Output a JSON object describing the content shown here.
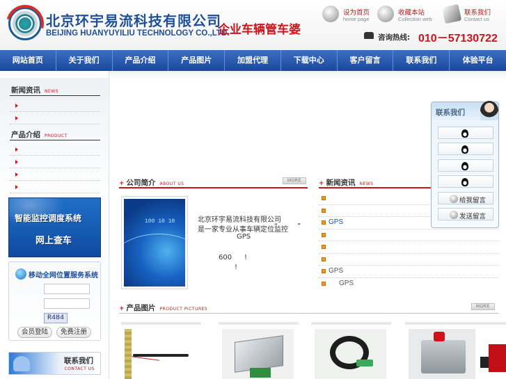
{
  "header": {
    "company_cn": "北京环宇易流科技有限公司",
    "company_en": "BEIJING HUANYUYILIU TECHNOLOGY CO.,LTD.",
    "slogan": "企业车辆管车婆",
    "links": [
      {
        "cn": "设为首页",
        "en": "home page",
        "icon": "globe-icon"
      },
      {
        "cn": "收藏本站",
        "en": "Collection web",
        "icon": "star-icon"
      },
      {
        "cn": "联系我们",
        "en": "Contact us",
        "icon": "book-icon"
      }
    ],
    "hotline_label": "咨询热线:",
    "hotline_number": "010－57130722"
  },
  "nav": [
    "网站首页",
    "关于我们",
    "产品介绍",
    "产品图片",
    "加盟代理",
    "下载中心",
    "客户留言",
    "联系我们",
    "体验平台"
  ],
  "sidebar": {
    "news_title": "新闻资讯",
    "news_sub": "NEWS",
    "product_title": "产品介绍",
    "product_sub": "PRODUCT",
    "banner_line1": "智能监控调度系统",
    "banner_line2": "网上查车",
    "login_title": "移动全网位置服务系统",
    "captcha": "R484",
    "login_button": "会员登陆",
    "register_button": "免费注册",
    "contact_title": "联系我们",
    "contact_sub": "CONTACT US"
  },
  "main": {
    "company_title": "公司简介",
    "company_sub": "ABOUT US",
    "company_more": "MORE",
    "company_text": {
      "line1": "北京环宇易流科技有限公司",
      "line2": "是一家专业从事车辆定位监控",
      "quote_open": "“",
      "quote_close": "”",
      "gps": "GPS",
      "number": "600",
      "excl1": "!",
      "excl2": "!"
    },
    "news_title": "新闻资讯",
    "news_sub": "NEWS",
    "news_items": [
      "",
      "",
      "GPS",
      "",
      "",
      "",
      "GPS",
      "GPS"
    ],
    "product_title": "产品图片",
    "product_sub": "PRODUCT PICTURES",
    "product_more": "MORE"
  },
  "float_panel": {
    "title": "联系我们",
    "message_button": "给我留言",
    "send_button": "发送留言"
  }
}
